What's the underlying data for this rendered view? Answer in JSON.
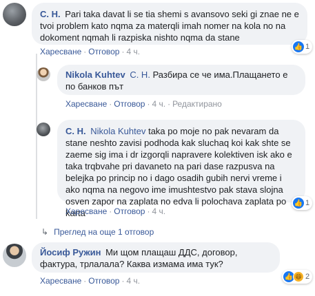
{
  "comments": [
    {
      "author": "С. Н.",
      "text": "Pari taka davat li se tia shemi s avansovo seki gi znae ne e tvoi problem kato nqma za materqli imah nomer na kola no na dokoment nqmah li razpiska nishto nqma da stane",
      "like_label": "Харесване",
      "reply_label": "Отговор",
      "time": "4 ч.",
      "reaction_count": "1"
    },
    {
      "author": "Nikola Kuhtev",
      "mention": "С. Н.",
      "text": "Разбира се че има.Плащането е по банков път",
      "like_label": "Харесване",
      "reply_label": "Отговор",
      "time": "4 ч.",
      "edited_label": "Редактирано"
    },
    {
      "author": "С. Н.",
      "mention": "Nikola Kuhtev",
      "text": "taka po moje no pak nevaram da stane neshto zavisi podhoda kak sluchaq koi kak shte se zaeme sig ima i dr izgorqli napravere kolektiven isk ako e taka trqbvahe pri davaneto na pari dase razpusva na belejka po princip no i dago osadih gubih nervi vreme i ako nqma na negovo ime imushtestvo pak stava slojna osven zapor na zaplata no edva li polochava zaplata po karta",
      "like_label": "Харесване",
      "reply_label": "Отговор",
      "time": "4 ч.",
      "reaction_count": "1"
    },
    {
      "author": "Йосиф Ружин",
      "text": "Ми щом плащаш ДДС, договор, фактура, трлалала? Каква измама има тук?",
      "like_label": "Харесване",
      "reply_label": "Отговор",
      "time": "4 ч.",
      "reaction_count": "2"
    }
  ],
  "more_replies_label": "Преглед на още 1 отговор",
  "separator": "·",
  "icons": {
    "like": "thumbs-up-icon",
    "haha": "laughing-face-icon",
    "reply_arrow": "reply-arrow-icon"
  },
  "colors": {
    "link": "#385898",
    "bubble": "#f0f2f5",
    "like": "#1877f2"
  }
}
